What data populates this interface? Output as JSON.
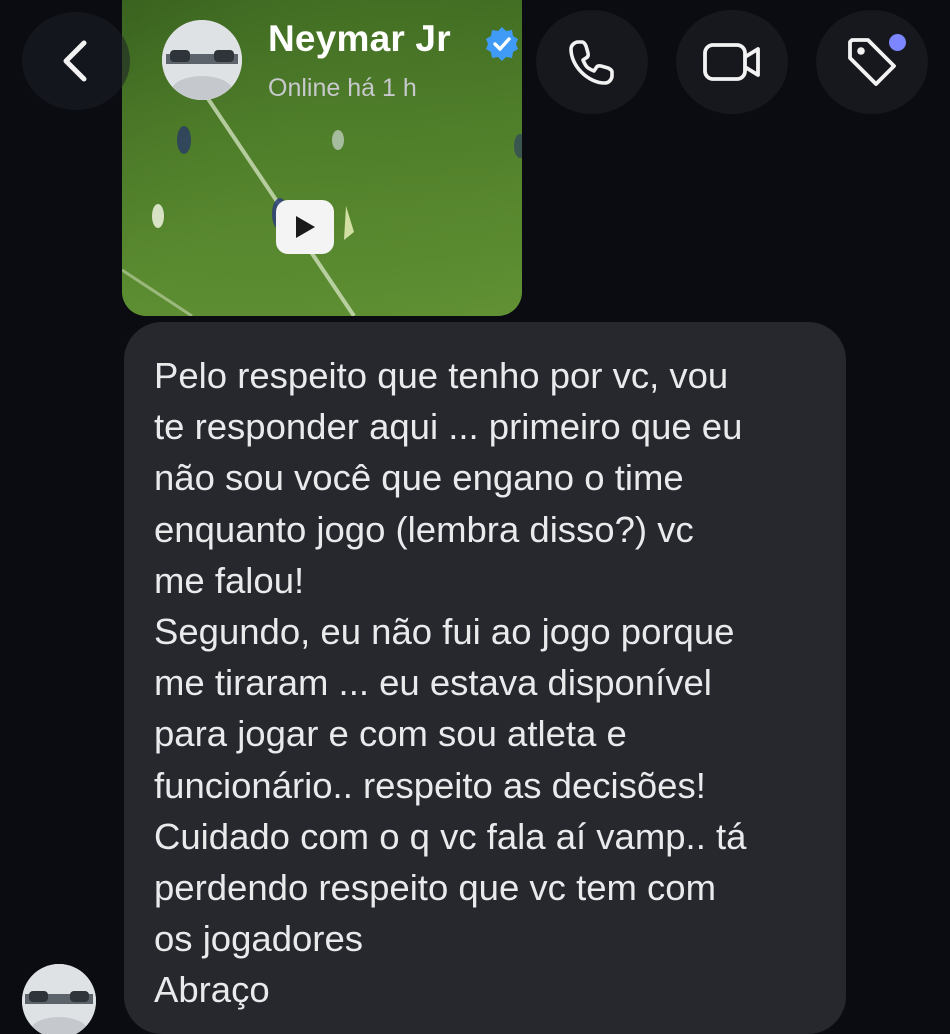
{
  "header": {
    "contact_name": "Neymar Jr",
    "status": "Online há 1 h",
    "icons": {
      "back": "chevron-left-icon",
      "verified": "verified-badge-icon",
      "call": "phone-icon",
      "video": "video-camera-icon",
      "tag": "tag-icon"
    },
    "accent_color": "#3f9bf5",
    "notification_dot_color": "#7b86ff"
  },
  "media": {
    "type": "video",
    "icon": "play-icon"
  },
  "message": {
    "text": "Pelo respeito que tenho por vc, vou\nte responder aqui ... primeiro que eu\nnão sou você que engano o time\nenquanto jogo (lembra disso?) vc\nme falou!\nSegundo, eu não fui ao jogo porque\nme tiraram ... eu estava disponível\npara jogar e com sou atleta e\nfuncionário.. respeito as decisões!\nCuidado com o q vc fala aí vamp.. tá\nperdendo respeito que vc tem com\nos jogadores\nAbraço"
  }
}
